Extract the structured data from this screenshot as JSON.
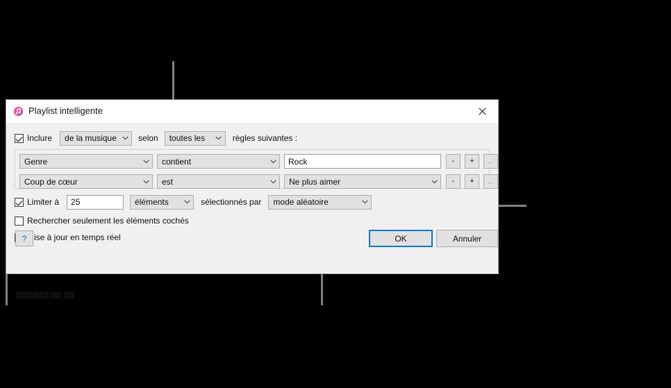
{
  "window": {
    "title": "Playlist intelligente",
    "icon": "itunes-note-icon",
    "close_label": "✕"
  },
  "include_row": {
    "checkbox_checked": true,
    "checkbox_label": "Inclure",
    "source_select": "de la musique",
    "connector_label": "selon",
    "match_select": "toutes les",
    "trailing_label": "règles suivantes :"
  },
  "rules": [
    {
      "field": "Genre",
      "operator": "contient",
      "value": "Rock",
      "value_type": "text",
      "remove_label": "-",
      "add_label": "+",
      "more_label": "..."
    },
    {
      "field": "Coup de cœur",
      "operator": "est",
      "value": "Ne plus aimer",
      "value_type": "select",
      "remove_label": "-",
      "add_label": "+",
      "more_label": "..."
    }
  ],
  "limit_row": {
    "checkbox_checked": true,
    "checkbox_label": "Limiter à",
    "amount": "25",
    "unit_select": "éléments",
    "middle_label": "sélectionnés par",
    "order_select": "mode aléatoire"
  },
  "options": [
    {
      "label": "Rechercher seulement les éléments cochés",
      "checked": false
    },
    {
      "label": "Mise à jour en temps réel",
      "checked": true
    }
  ],
  "footer": {
    "help_label": "?",
    "ok_label": "OK",
    "cancel_label": "Annuler"
  },
  "clipped_text": "░░░░░░ ░░ ░░",
  "colors": {
    "background": "#000000",
    "dialog": "#f0f0f0",
    "titlebar": "#ffffff",
    "accent": "#0078d7",
    "leader_line": "#808080",
    "help_glyph": "#2f5fa8"
  },
  "callouts": [
    {
      "name": "match-select-callout",
      "target": "toutes les"
    },
    {
      "name": "order-select-callout",
      "target": "mode aléatoire"
    },
    {
      "name": "checked-only-callout",
      "target": "Rechercher seulement les éléments cochés"
    },
    {
      "name": "live-update-callout",
      "target": "Mise à jour en temps réel"
    }
  ]
}
